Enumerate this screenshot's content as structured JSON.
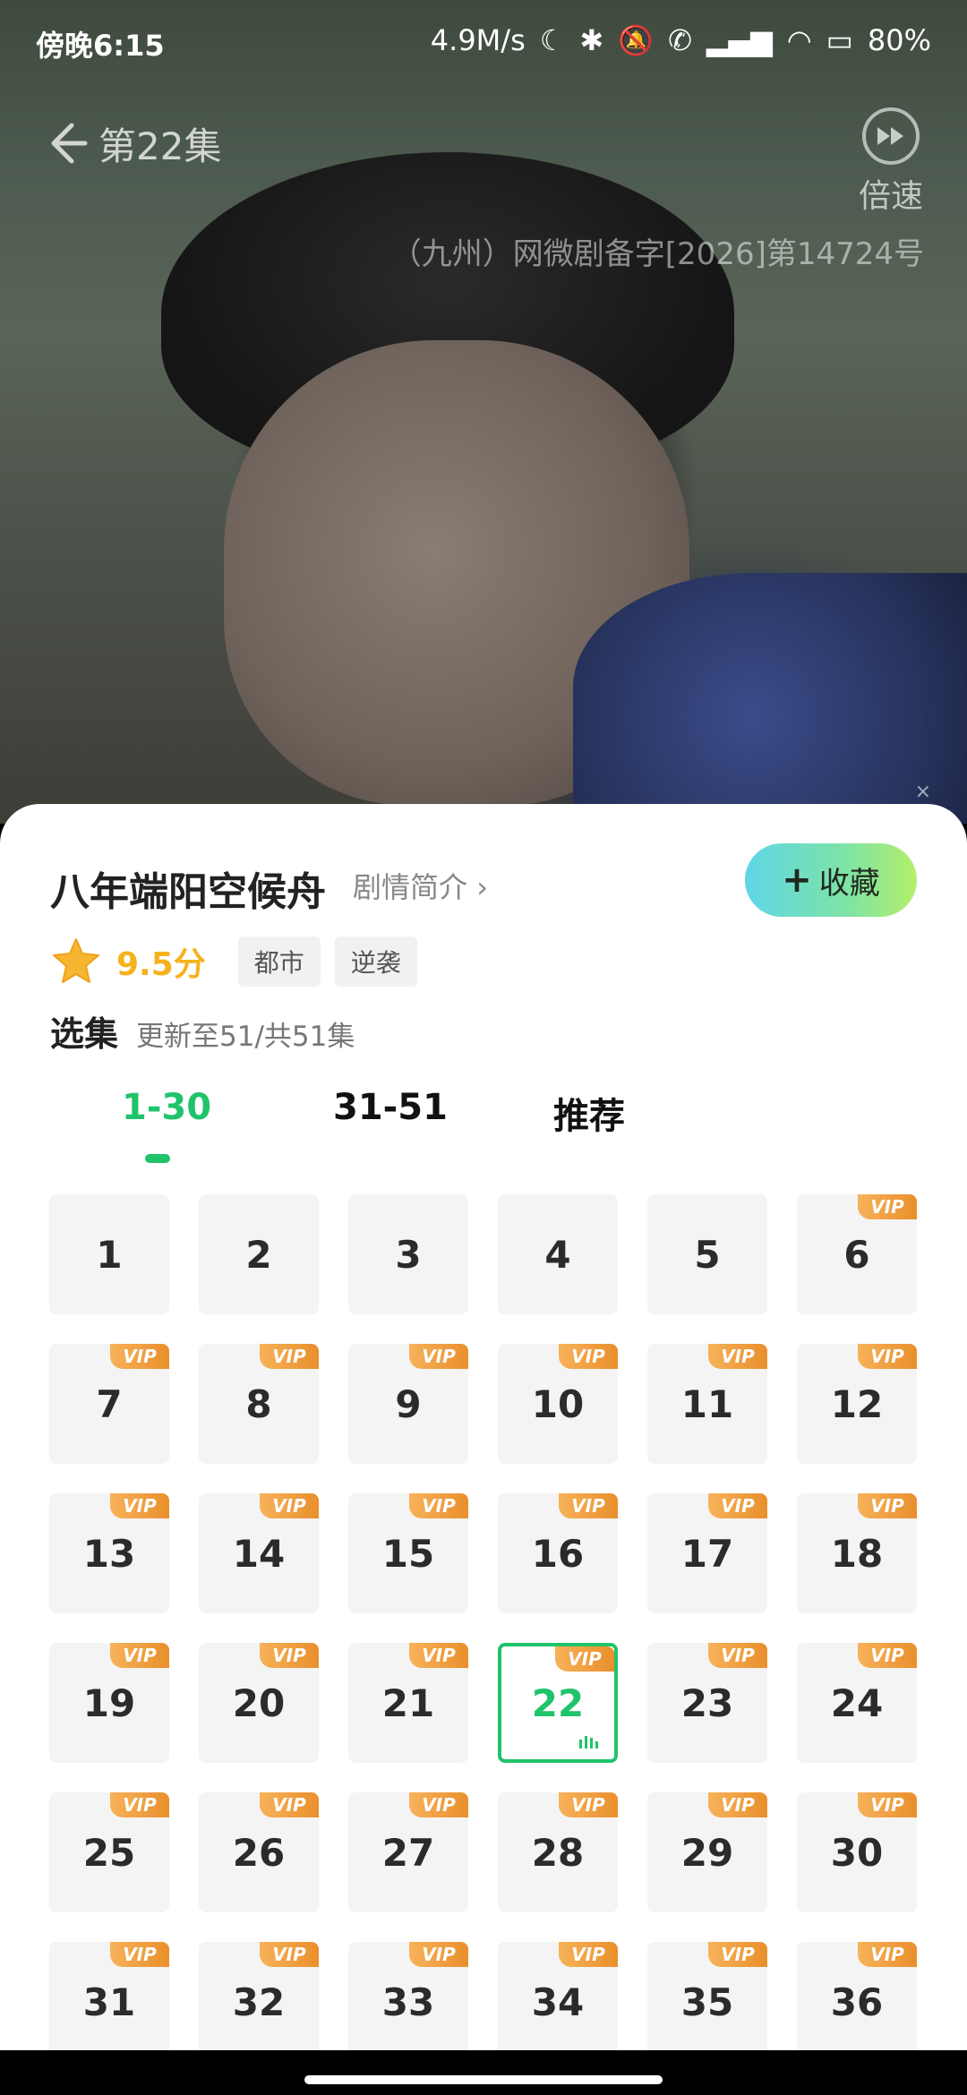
{
  "status_bar": {
    "time": "傍晚6:15",
    "speed": "4.9M/s",
    "battery": "80%"
  },
  "player": {
    "episode_title": "第22集",
    "speed_label": "倍速",
    "watermark": "（九州）网微剧备字[2026]第14724号",
    "close": "×"
  },
  "show": {
    "title": "八年端阳空候舟",
    "synopsis_link": "剧情简介",
    "favorite_label": "收藏",
    "rating": "9.5分",
    "tags": [
      "都市",
      "逆袭"
    ],
    "episodes_label": "选集",
    "episodes_update": "更新至51/共51集"
  },
  "tabs": [
    {
      "label": "1-30"
    },
    {
      "label": "31-51"
    },
    {
      "label": "推荐"
    }
  ],
  "vip_badge": "VIP",
  "episodes": [
    "1",
    "2",
    "3",
    "4",
    "5",
    "6",
    "7",
    "8",
    "9",
    "10",
    "11",
    "12",
    "13",
    "14",
    "15",
    "16",
    "17",
    "18",
    "19",
    "20",
    "21",
    "22",
    "23",
    "24",
    "25",
    "26",
    "27",
    "28",
    "29",
    "30",
    "31",
    "32",
    "33",
    "34",
    "35",
    "36"
  ],
  "current_episode": "22",
  "vip_from_episode": 6,
  "colors": {
    "accent_green": "#1fc46a",
    "rating_gold": "#f5b21e",
    "vip_orange": "#e98f2c"
  }
}
